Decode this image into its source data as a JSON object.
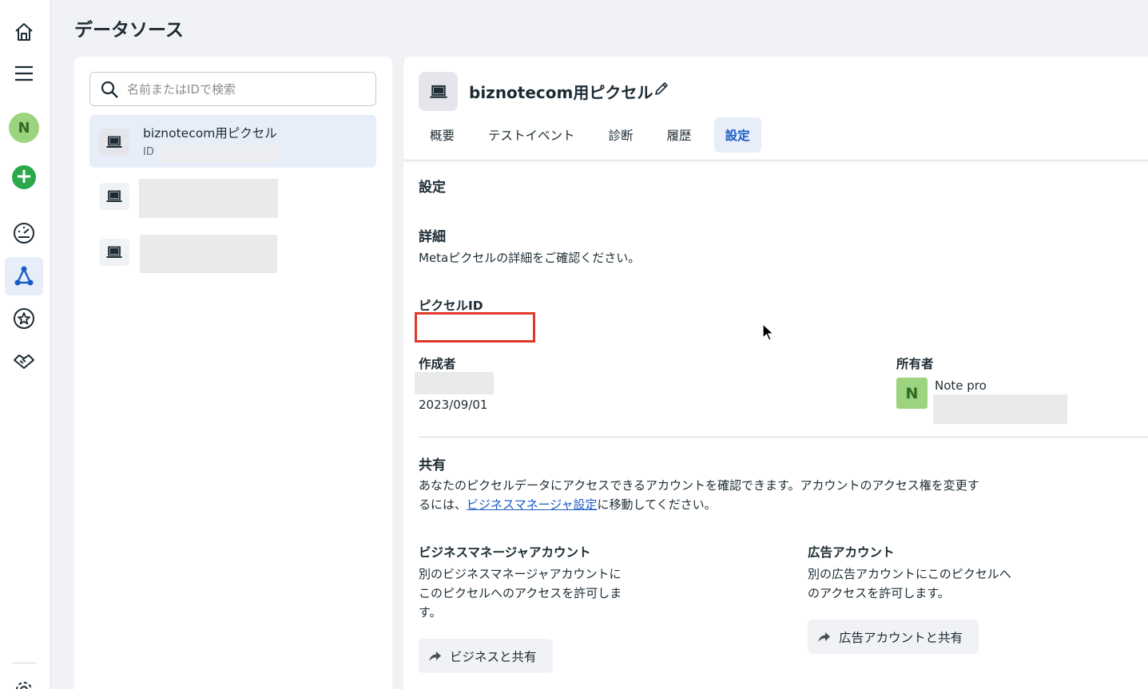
{
  "page": {
    "title": "データソース"
  },
  "rail": {
    "avatar_letter": "N",
    "items": [
      {
        "icon": "home-icon"
      },
      {
        "icon": "menu-icon"
      },
      {
        "icon": "avatar"
      },
      {
        "icon": "add-icon"
      },
      {
        "icon": "dashboard-gauge-icon"
      },
      {
        "icon": "data-sources-icon",
        "active": true
      },
      {
        "icon": "star-badge-icon"
      },
      {
        "icon": "partnership-icon"
      },
      {
        "icon": "settings-gear-icon"
      }
    ]
  },
  "search": {
    "placeholder": "名前またはIDで検索"
  },
  "list": {
    "items": [
      {
        "name": "biznotecom用ピクセル",
        "id_label": "ID",
        "selected": true
      }
    ]
  },
  "detail": {
    "title": "biznotecom用ピクセル",
    "tabs": [
      {
        "label": "概要"
      },
      {
        "label": "テストイベント"
      },
      {
        "label": "診断"
      },
      {
        "label": "履歴"
      },
      {
        "label": "設定",
        "active": true
      }
    ],
    "settings_heading": "設定",
    "details": {
      "heading": "詳細",
      "description": "Metaピクセルの詳細をご確認ください。",
      "pixel_id_label": "ピクセルID",
      "creator_label": "作成者",
      "created_date": "2023/09/01",
      "owner_label": "所有者",
      "owner_avatar_letter": "N",
      "owner_name": "Note pro"
    },
    "sharing": {
      "heading": "共有",
      "description_line1": "あなたのピクセルデータにアクセスできるアカウントを確認できます。アカウントのアクセス権を変更す",
      "description_line2_prefix": "るには、",
      "description_link": "ビジネスマネージャ設定",
      "description_line2_suffix": "に移動してください。",
      "business_heading": "ビジネスマネージャアカウント",
      "business_desc_1": "別のビジネスマネージャアカウントに",
      "business_desc_2": "このピクセルへのアクセスを許可しま",
      "business_desc_3": "す。",
      "business_button": "ビジネスと共有",
      "ad_heading": "広告アカウント",
      "ad_desc_1": "別の広告アカウントにこのピクセルへ",
      "ad_desc_2": "のアクセスを許可します。",
      "ad_button": "広告アカウントと共有"
    }
  },
  "colors": {
    "accent": "#1a5bc4",
    "selected_bg": "#e7eef9",
    "highlight_border": "#e0392b",
    "avatar_green": "#9bd37e",
    "add_green": "#2aa84a"
  }
}
